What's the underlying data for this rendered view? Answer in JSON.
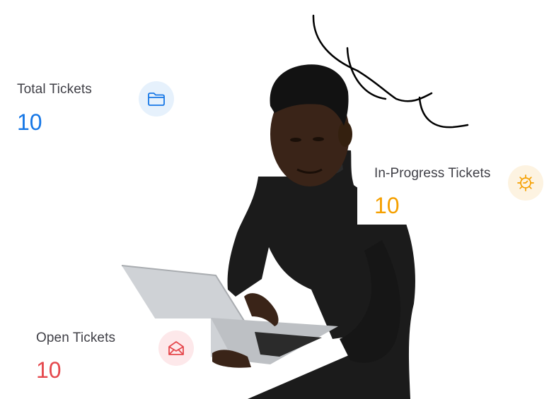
{
  "stats": {
    "total": {
      "label": "Total Tickets",
      "value": "10",
      "color": "#1677e6",
      "icon_bg": "#e6f1fc",
      "icon": "folder-icon"
    },
    "in_progress": {
      "label": "In-Progress Tickets",
      "value": "10",
      "color": "#f5a000",
      "icon_bg": "#fdf3e1",
      "icon": "gear-icon"
    },
    "open": {
      "label": "Open Tickets",
      "value": "10",
      "color": "#e5484d",
      "icon_bg": "#fde8ea",
      "icon": "open-envelope-icon"
    }
  }
}
